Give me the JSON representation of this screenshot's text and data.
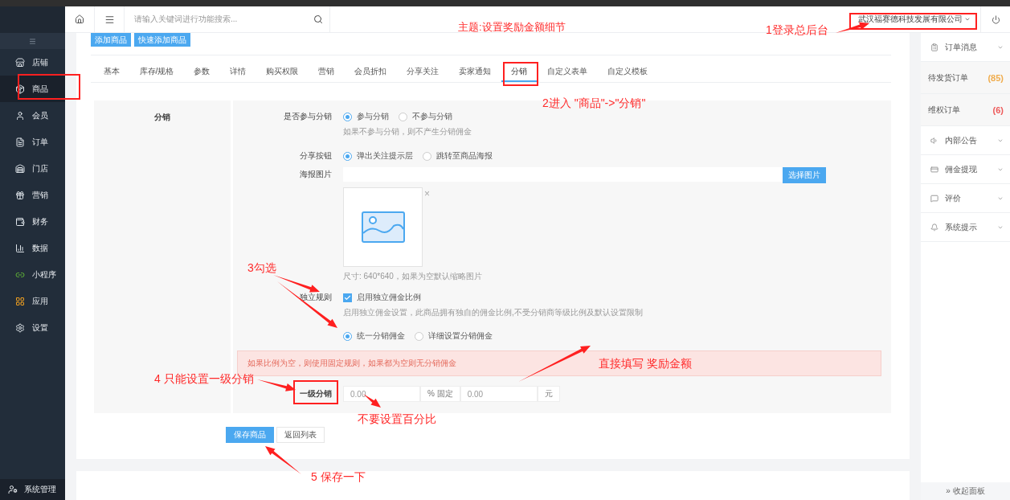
{
  "header": {
    "search_placeholder": "请输入关键词进行功能搜索...",
    "account": "武汉福赛德科技发展有限公司"
  },
  "sidebar": {
    "items": [
      {
        "label": "店铺",
        "selected": false
      },
      {
        "label": "商品",
        "selected": true
      },
      {
        "label": "会员",
        "selected": false
      },
      {
        "label": "订单",
        "selected": false
      },
      {
        "label": "门店",
        "selected": false
      },
      {
        "label": "营销",
        "selected": false
      },
      {
        "label": "财务",
        "selected": false
      },
      {
        "label": "数据",
        "selected": false
      },
      {
        "label": "小程序",
        "selected": false
      },
      {
        "label": "应用",
        "selected": false
      },
      {
        "label": "设置",
        "selected": false
      }
    ],
    "footer": "系统管理"
  },
  "toolbar": {
    "buttons": [
      "添加商品",
      "快速添加商品"
    ]
  },
  "tabs": [
    {
      "label": "基本",
      "selected": false
    },
    {
      "label": "库存/规格",
      "selected": false
    },
    {
      "label": "参数",
      "selected": false
    },
    {
      "label": "详情",
      "selected": false
    },
    {
      "label": "购买权限",
      "selected": false
    },
    {
      "label": "营销",
      "selected": false
    },
    {
      "label": "会员折扣",
      "selected": false
    },
    {
      "label": "分享关注",
      "selected": false
    },
    {
      "label": "卖家通知",
      "selected": false
    },
    {
      "label": "分销",
      "selected": true
    },
    {
      "label": "自定义表单",
      "selected": false
    },
    {
      "label": "自定义模板",
      "selected": false
    }
  ],
  "form": {
    "section_title": "分销",
    "participate": {
      "label": "是否参与分销",
      "options": [
        {
          "label": "参与分销",
          "selected": true
        },
        {
          "label": "不参与分销",
          "selected": false
        }
      ],
      "help": "如果不参与分销，则不产生分销佣金"
    },
    "share_button": {
      "label": "分享按钮",
      "options": [
        {
          "label": "弹出关注提示层",
          "selected": true
        },
        {
          "label": "跳转至商品海报",
          "selected": false
        }
      ]
    },
    "poster": {
      "label": "海报图片",
      "button": "选择图片",
      "remove": "×",
      "help": "尺寸: 640*640，如果为空默认缩略图片"
    },
    "independent": {
      "label": "独立规则",
      "checkbox": {
        "label": "启用独立佣金比例",
        "checked": true
      },
      "help": "启用独立佣金设置，此商品拥有独自的佣金比例,不受分销商等级比例及默认设置限制",
      "options": [
        {
          "label": "统一分销佣金",
          "selected": true
        },
        {
          "label": "详细设置分销佣金",
          "selected": false
        }
      ]
    },
    "alert": "如果比例为空，则使用固定规则，如果都为空则无分销佣金",
    "level_one": {
      "label": "一级分销",
      "percent_placeholder": "0.00",
      "percent_addon": "% 固定",
      "fixed_placeholder": "0.00",
      "fixed_addon": "元"
    }
  },
  "actions": [
    "保存商品",
    "返回列表"
  ],
  "right_panel": {
    "items": [
      {
        "kind": "menu",
        "label": "订单消息"
      },
      {
        "kind": "count",
        "label": "待发货订单",
        "count": "(85)",
        "color": "#f0ad4e"
      },
      {
        "kind": "count",
        "label": "维权订单",
        "count": "(6)",
        "color": "#ee5a5a"
      },
      {
        "kind": "menu",
        "label": "内部公告"
      },
      {
        "kind": "menu",
        "label": "佣金提现"
      },
      {
        "kind": "menu",
        "label": "评价"
      },
      {
        "kind": "menu",
        "label": "系统提示"
      }
    ],
    "collapse": "» 收起面板"
  },
  "annotations": [
    {
      "text": "主题:设置奖励金额细节"
    },
    {
      "text": "1登录总后台"
    },
    {
      "text": "2进入 \"商品\"->\"分销\""
    },
    {
      "text": "3勾选"
    },
    {
      "text": "直接填写 奖励金额"
    },
    {
      "text": "4 只能设置一级分销"
    },
    {
      "text": "不要设置百分比"
    },
    {
      "text": "5 保存一下"
    }
  ]
}
